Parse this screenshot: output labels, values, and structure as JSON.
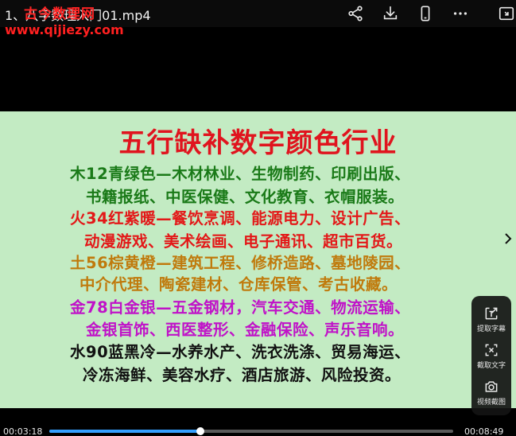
{
  "header": {
    "file_title": "1、八字数理入门01.mp4",
    "watermark_text": "古今数理网",
    "watermark_url": "www.qijiezy.com",
    "icons": [
      "share-icon",
      "download-icon",
      "phone-icon",
      "more-icon",
      "exit-fullscreen-icon"
    ]
  },
  "video": {
    "title": "五行缺补数字颜色行业",
    "lines": [
      "木12青绿色—木材林业、生物制药、印刷出版、",
      "书籍报纸、中医保健、文化教育、衣帽服装。",
      "火34红紫暖—餐饮烹调、能源电力、设计广告、",
      "动漫游戏、美术绘画、电子通讯、超市百货。",
      "土56棕黄橙—建筑工程、修桥造路、墓地陵园、",
      "中介代理、陶瓷建材、仓库保管、考古收藏。",
      "金78白金银—五金钢材，汽车交通、物流运输、",
      "金银首饰、西医整形、金融保险、声乐音响。",
      "水90蓝黑冷—水养水产、洗衣洗涤、贸易海运、",
      "冷冻海鲜、美容水疗、酒店旅游、风险投资。"
    ]
  },
  "side_panel": {
    "items": [
      {
        "icon": "extract-subtitle-icon",
        "label": "提取字幕"
      },
      {
        "icon": "capture-text-icon",
        "label": "截取文字"
      },
      {
        "icon": "camera-icon",
        "label": "视频截图"
      }
    ]
  },
  "player": {
    "current_time": "00:03:18",
    "total_time": "00:08:49",
    "progress": 0.374
  },
  "colors": {
    "slide_bg": "#c3ebc3",
    "title_red": "#e0141e",
    "wood_green": "#1a7a18",
    "fire_red": "#e31818",
    "earth_brown": "#c07a0c",
    "metal_purple": "#c012c8",
    "water_black": "#111111",
    "progress_blue": "#35a0ff"
  }
}
